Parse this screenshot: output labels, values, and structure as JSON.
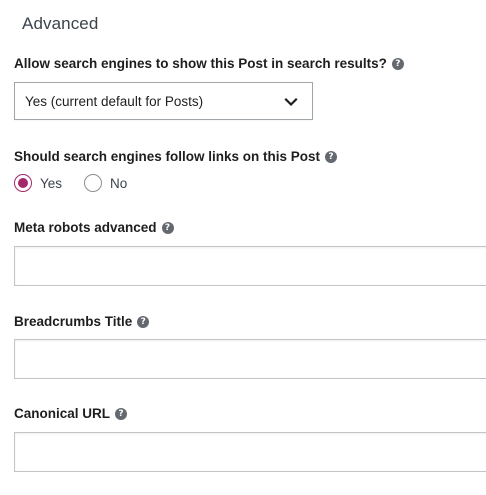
{
  "section": {
    "title": "Advanced"
  },
  "search_visibility": {
    "label": "Allow search engines to show this Post in search results?",
    "help_icon": "help-icon",
    "selected_value": "Yes (current default for Posts)"
  },
  "follow_links": {
    "label": "Should search engines follow links on this Post",
    "help_icon": "help-icon",
    "options": [
      {
        "label": "Yes",
        "checked": true
      },
      {
        "label": "No",
        "checked": false
      }
    ]
  },
  "meta_robots": {
    "label": "Meta robots advanced",
    "help_icon": "help-icon",
    "value": "",
    "placeholder": ""
  },
  "breadcrumbs_title": {
    "label": "Breadcrumbs Title",
    "help_icon": "help-icon",
    "value": "",
    "placeholder": ""
  },
  "canonical_url": {
    "label": "Canonical URL",
    "help_icon": "help-icon",
    "value": "",
    "placeholder": ""
  },
  "colors": {
    "accent": "#a4286a",
    "help_icon_bg": "#646970",
    "border": "#c3c4c7"
  }
}
